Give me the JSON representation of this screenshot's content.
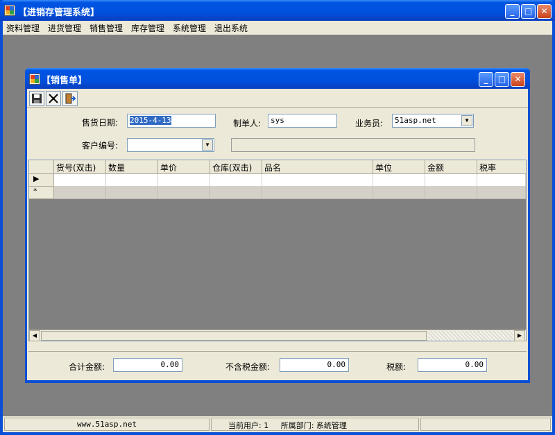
{
  "app": {
    "title": "【进销存管理系统】"
  },
  "menu": [
    "资料管理",
    "进货管理",
    "销售管理",
    "库存管理",
    "系统管理",
    "退出系统"
  ],
  "child": {
    "title": "【销售单】"
  },
  "toolbar": {
    "icons": [
      "save-icon",
      "delete-icon",
      "exit-icon"
    ]
  },
  "form": {
    "sale_date_label": "售货日期:",
    "sale_date_value": "2015-4-13",
    "maker_label": "制单人:",
    "maker_value": "sys",
    "salesman_label": "业务员:",
    "salesman_value": "51asp.net",
    "customer_label": "客户编号:",
    "customer_value": ""
  },
  "grid": {
    "columns": [
      "货号(双击)",
      "数量",
      "单价",
      "仓库(双击)",
      "品名",
      "单位",
      "金额",
      "税率"
    ],
    "row_markers": [
      "▶",
      "*"
    ]
  },
  "totals": {
    "total_label": "合计金额:",
    "total_value": "0.00",
    "pretax_label": "不含税金额:",
    "pretax_value": "0.00",
    "tax_label": "税额:",
    "tax_value": "0.00"
  },
  "status": {
    "site": "www.51asp.net",
    "user_label": "当前用户:",
    "user_value": "1",
    "dept_label": "所属部门:",
    "dept_value": "系统管理"
  },
  "colors": {
    "titlebar": "#0054e3",
    "face": "#ece9d8",
    "mdi_bg": "#808080",
    "selection": "#316ac5"
  }
}
